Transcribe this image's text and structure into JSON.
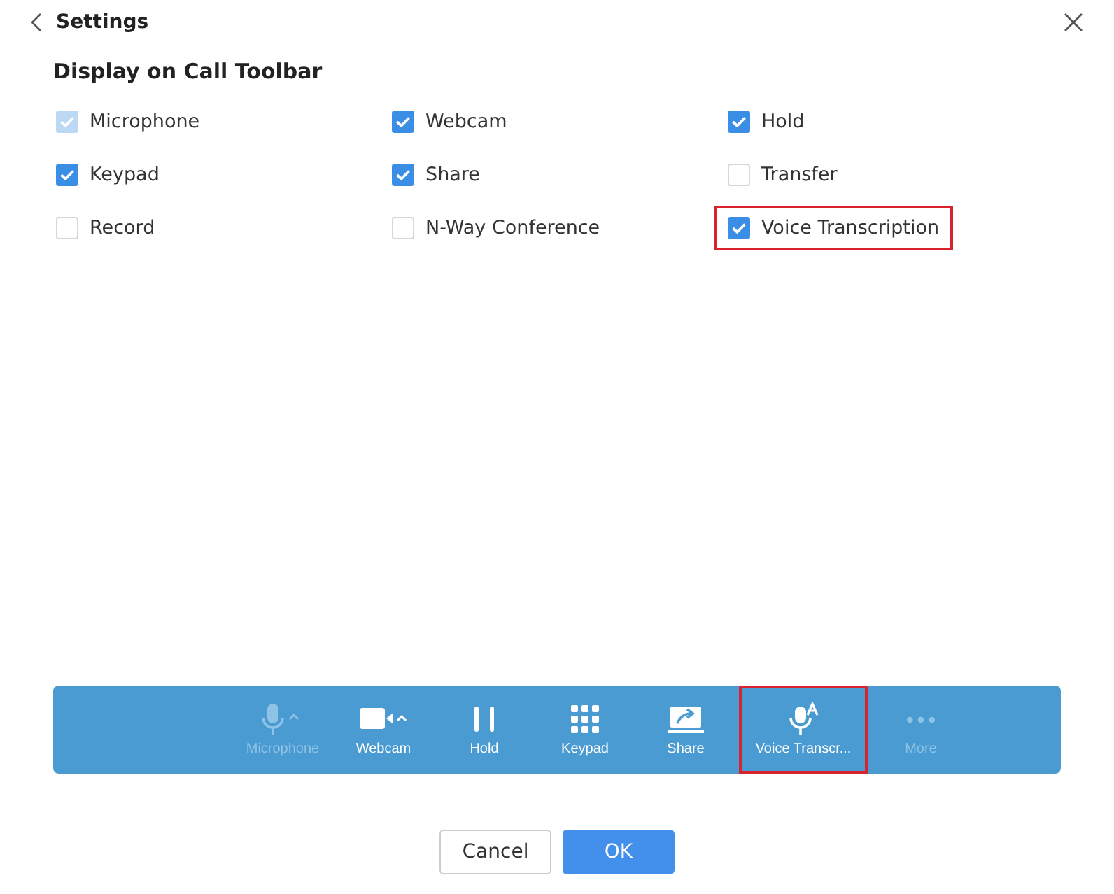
{
  "window": {
    "title": "Settings"
  },
  "section": {
    "title": "Display on Call Toolbar"
  },
  "options": [
    {
      "label": "Microphone",
      "checked": true,
      "disabled": true,
      "highlighted": false
    },
    {
      "label": "Webcam",
      "checked": true,
      "disabled": false,
      "highlighted": false
    },
    {
      "label": "Hold",
      "checked": true,
      "disabled": false,
      "highlighted": false
    },
    {
      "label": "Keypad",
      "checked": true,
      "disabled": false,
      "highlighted": false
    },
    {
      "label": "Share",
      "checked": true,
      "disabled": false,
      "highlighted": false
    },
    {
      "label": "Transfer",
      "checked": false,
      "disabled": false,
      "highlighted": false
    },
    {
      "label": "Record",
      "checked": false,
      "disabled": false,
      "highlighted": false
    },
    {
      "label": "N-Way Conference",
      "checked": false,
      "disabled": false,
      "highlighted": false
    },
    {
      "label": "Voice Transcription",
      "checked": true,
      "disabled": false,
      "highlighted": true
    }
  ],
  "toolbar": [
    {
      "kind": "microphone",
      "label": "Microphone",
      "disabled": true,
      "highlighted": false
    },
    {
      "kind": "webcam",
      "label": "Webcam",
      "disabled": false,
      "highlighted": false
    },
    {
      "kind": "hold",
      "label": "Hold",
      "disabled": false,
      "highlighted": false
    },
    {
      "kind": "keypad",
      "label": "Keypad",
      "disabled": false,
      "highlighted": false
    },
    {
      "kind": "share",
      "label": "Share",
      "disabled": false,
      "highlighted": false
    },
    {
      "kind": "transcription",
      "label": "Voice Transcr...",
      "disabled": false,
      "highlighted": true
    },
    {
      "kind": "more",
      "label": "More",
      "disabled": true,
      "highlighted": false
    }
  ],
  "buttons": [
    {
      "label": "Cancel",
      "kind": "secondary"
    },
    {
      "label": "OK",
      "kind": "primary"
    }
  ]
}
